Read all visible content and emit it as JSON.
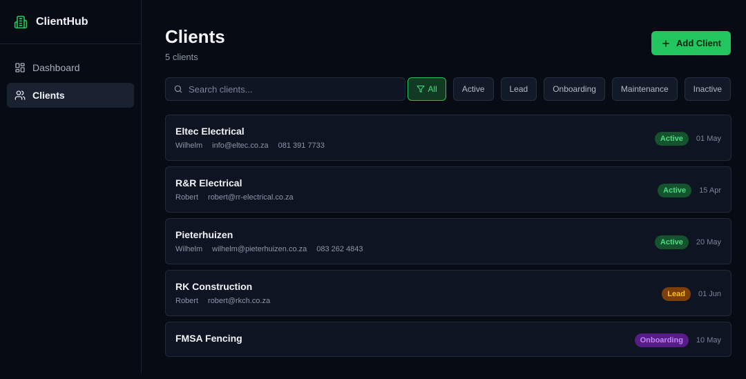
{
  "brand": {
    "name": "ClientHub"
  },
  "nav": {
    "dashboard": "Dashboard",
    "clients": "Clients"
  },
  "header": {
    "title": "Clients",
    "subtitle": "5 clients",
    "add_label": "Add Client"
  },
  "search": {
    "placeholder": "Search clients..."
  },
  "filters": {
    "all": "All",
    "active": "Active",
    "lead": "Lead",
    "onboarding": "Onboarding",
    "maintenance": "Maintenance",
    "inactive": "Inactive"
  },
  "clients": [
    {
      "name": "Eltec Electrical",
      "contact": "Wilhelm",
      "email": "info@eltec.co.za",
      "phone": "081 391 7733",
      "status": "Active",
      "date": "01 May"
    },
    {
      "name": "R&R Electrical",
      "contact": "Robert",
      "email": "robert@rr-electrical.co.za",
      "phone": "",
      "status": "Active",
      "date": "15 Apr"
    },
    {
      "name": "Pieterhuizen",
      "contact": "Wilhelm",
      "email": "wilhelm@pieterhuizen.co.za",
      "phone": "083 262 4843",
      "status": "Active",
      "date": "20 May"
    },
    {
      "name": "RK Construction",
      "contact": "Robert",
      "email": "robert@rkch.co.za",
      "phone": "",
      "status": "Lead",
      "date": "01 Jun"
    },
    {
      "name": "FMSA Fencing",
      "contact": "",
      "email": "",
      "phone": "",
      "status": "Onboarding",
      "date": "10 May"
    }
  ],
  "colors": {
    "accent": "#22c55e",
    "background": "#070b14",
    "card": "#0e1422",
    "status_active": "#4ade80",
    "status_lead": "#fbbf24",
    "status_onboarding": "#c084fc"
  },
  "icons": {
    "brand": "building-icon",
    "dashboard": "grid-icon",
    "clients": "users-icon",
    "add": "plus-icon",
    "search": "search-icon",
    "filter": "filter-icon"
  }
}
